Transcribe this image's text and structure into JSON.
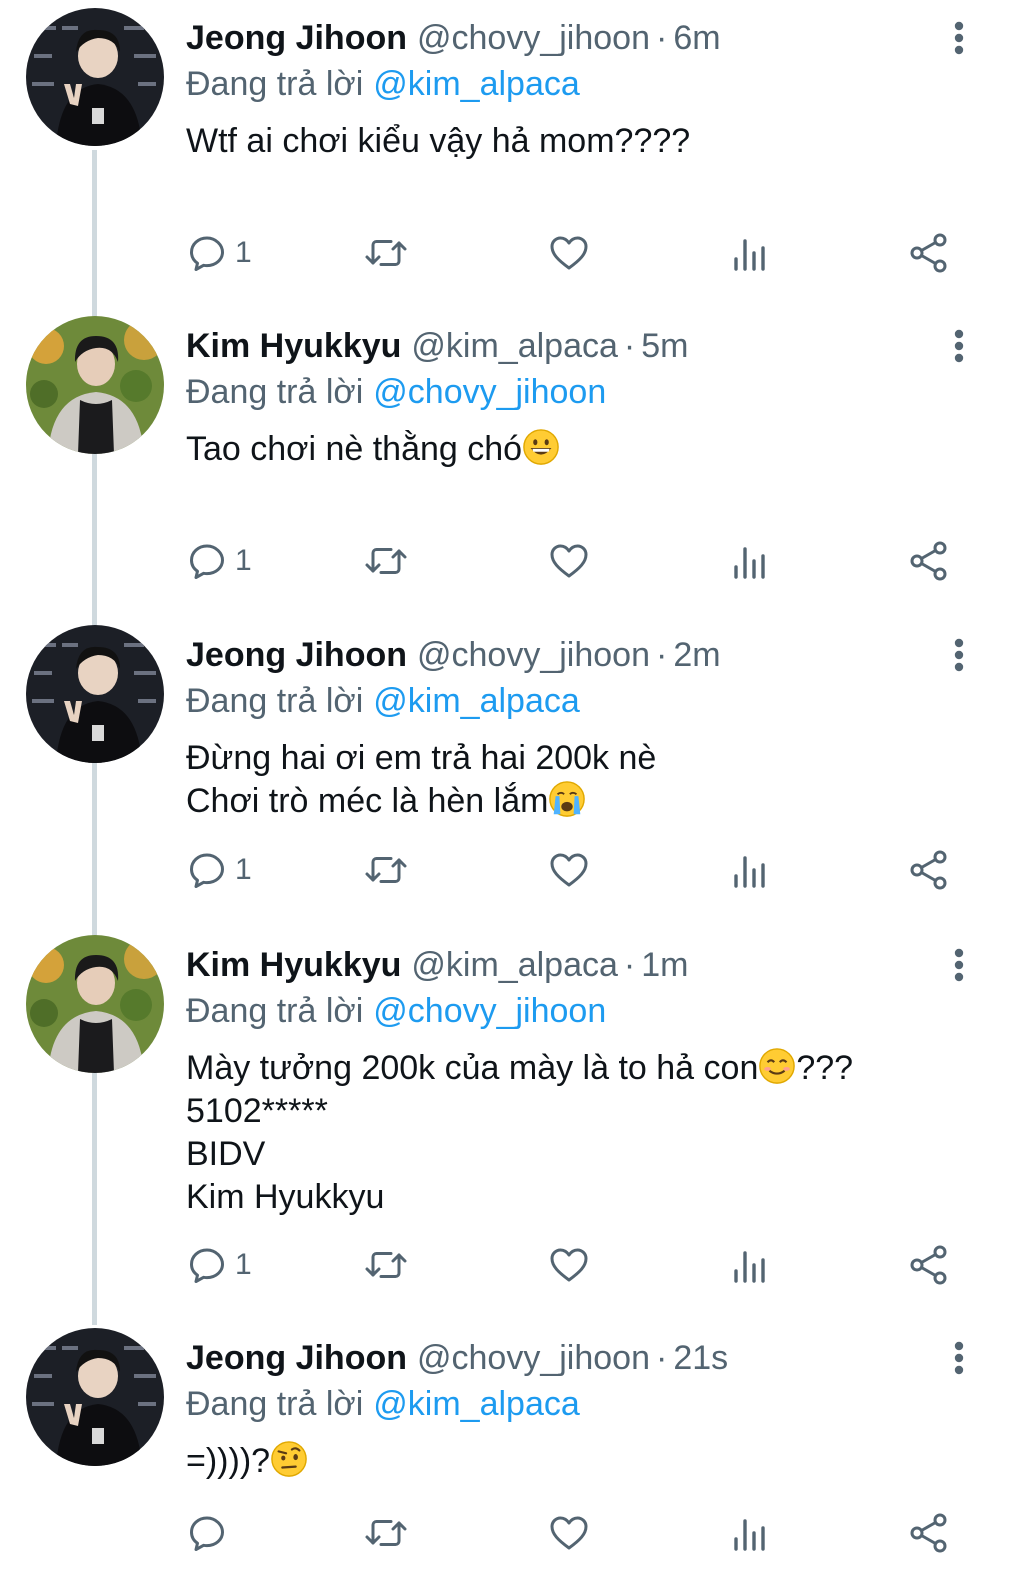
{
  "tweets": [
    {
      "name": "Jeong Jihoon",
      "handle": "@chovy_jihoon",
      "time": "6m",
      "replying_prefix": "Đang trả lời",
      "replying_to": "@kim_alpaca",
      "lines": [
        "Wtf ai chơi kiểu vậy hả mom????"
      ],
      "reply_count": "1"
    },
    {
      "name": "Kim Hyukkyu",
      "handle": "@kim_alpaca",
      "time": "5m",
      "replying_prefix": "Đang trả lời",
      "replying_to": "@chovy_jihoon",
      "lines": [
        "Tao chơi nè thằng chó"
      ],
      "reply_count": "1"
    },
    {
      "name": "Jeong Jihoon",
      "handle": "@chovy_jihoon",
      "time": "2m",
      "replying_prefix": "Đang trả lời",
      "replying_to": "@kim_alpaca",
      "lines": [
        "Đừng hai ơi em trả hai 200k nè",
        "Chơi trò méc là hèn lắm"
      ],
      "reply_count": "1"
    },
    {
      "name": "Kim Hyukkyu",
      "handle": "@kim_alpaca",
      "time": "1m",
      "replying_prefix": "Đang trả lời",
      "replying_to": "@chovy_jihoon",
      "lines": [
        "Mày tưởng 200k của mày là to hả con",
        "???",
        "5102*****",
        "BIDV",
        "Kim Hyukkyu"
      ],
      "reply_count": "1"
    },
    {
      "name": "Jeong Jihoon",
      "handle": "@chovy_jihoon",
      "time": "21s",
      "replying_prefix": "Đang trả lời",
      "replying_to": "@kim_alpaca",
      "lines": [
        "=))))?"
      ],
      "reply_count": ""
    }
  ],
  "colors": {
    "text": "#0f1419",
    "secondary": "#536471",
    "link": "#1d9bf0",
    "thread_line": "#cfd9de"
  },
  "icons": [
    "reply-icon",
    "retweet-icon",
    "like-icon",
    "stats-icon",
    "share-icon",
    "more-icon",
    "grinning-emoji",
    "crying-emoji",
    "smiling-emoji",
    "raised-eyebrow-emoji"
  ]
}
